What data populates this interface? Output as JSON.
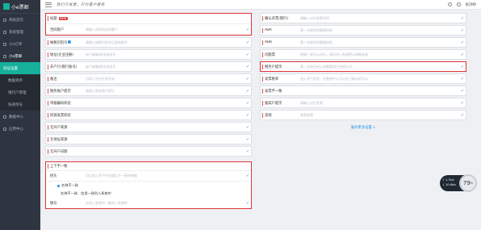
{
  "app": {
    "title": "小e票邮"
  },
  "topbar": {
    "slogan": "我们只发票，只为客户服务",
    "user": "张浏桥"
  },
  "sidebar": {
    "items": [
      {
        "label": "系统首页",
        "type": "top"
      },
      {
        "label": "系统管理",
        "type": "top"
      },
      {
        "label": "小e订单",
        "type": "top"
      },
      {
        "label": "小e票邮",
        "type": "open"
      },
      {
        "label": "验证设置",
        "type": "active"
      },
      {
        "label": "数据清单",
        "type": "sub"
      },
      {
        "label": "银行户管理",
        "type": "sub"
      },
      {
        "label": "快递单号",
        "type": "sub"
      },
      {
        "label": "数据中心",
        "type": "top"
      },
      {
        "label": "应用中心",
        "type": "top"
      }
    ]
  },
  "left": {
    "group1": {
      "rows": [
        {
          "label": "标题",
          "badge": "NEW",
          "hint": "",
          "check": "✓"
        },
        {
          "label": "合同客户",
          "hint": "请输入合同的合同客户",
          "check": "✓"
        }
      ]
    },
    "rows": [
      {
        "label": "纳税识别号",
        "info": "i",
        "hint": "请输入纳税识别号后面的税号",
        "check": "✓"
      },
      {
        "label": "地址(企业注册)",
        "hint": "电子邮箱/联系电话号",
        "check": "✓"
      },
      {
        "label": "开户行(银行账号)",
        "hint": "电子邮箱/联系电话号",
        "check": "✓"
      },
      {
        "label": "备注",
        "hint": "当前人员在在线开始",
        "check": "✓"
      },
      {
        "label": "税务账户提示",
        "hint": "请输入税务账户提示",
        "check": "✓"
      },
      {
        "label": "单据编码校验",
        "hint": "",
        "check": "✓"
      },
      {
        "label": "同源发票校验",
        "hint": "",
        "check": "✓"
      },
      {
        "label": "无开户来源",
        "hint": "",
        "check": "✓"
      },
      {
        "label": "无地址来源",
        "hint": "",
        "check": "✓"
      },
      {
        "label": "无开户日期",
        "hint": "",
        "check": "✓"
      }
    ],
    "group2": {
      "label": "上下不一致",
      "row1": {
        "label": "抬头",
        "hint": "可以进入开户行扫描后不一致的单据",
        "check": "✓"
      },
      "radio_title": "名称不一致",
      "radio_option": "名称不一致、信用一致列入系统中",
      "row2": {
        "label": "税号",
        "hint": "在进入系统中一致列入系统中",
        "check": "✓"
      }
    }
  },
  "right": {
    "rows": [
      {
        "label": "确认开票(银行)",
        "hint": "请输入对方发票号码",
        "check": "✓"
      },
      {
        "label": "ABA",
        "hint": "第一次使用时需要授权",
        "check": "✓"
      },
      {
        "label": "ABB",
        "hint": "第一次使用时需要授权",
        "check": "✓"
      },
      {
        "label": "问题票",
        "hint": "根据一致可以对方，然后进入系统提示单据系统",
        "check": "✓",
        "highlight": false
      },
      {
        "label": "税务户提示",
        "hint": "第一次单位进入时需要用已在提示内",
        "check": "✓",
        "highlight": true
      },
      {
        "label": "发票税率",
        "hint": "进入开户信息，在数据中心可以在已确认的可以",
        "check": "✓"
      },
      {
        "label": "发票不一致",
        "hint": "",
        "check": "✓"
      },
      {
        "label": "备案户提示",
        "hint": "请输入对方发票",
        "check": "✓"
      },
      {
        "label": "其他",
        "hint": "其他发票",
        "check": "✓"
      }
    ],
    "expand": "展开更多设置 ∨"
  },
  "float": {
    "up": "↑ 1.7k/s",
    "down": "↓ 10.6k/s",
    "percent": "79",
    "pct_sign": "%"
  }
}
